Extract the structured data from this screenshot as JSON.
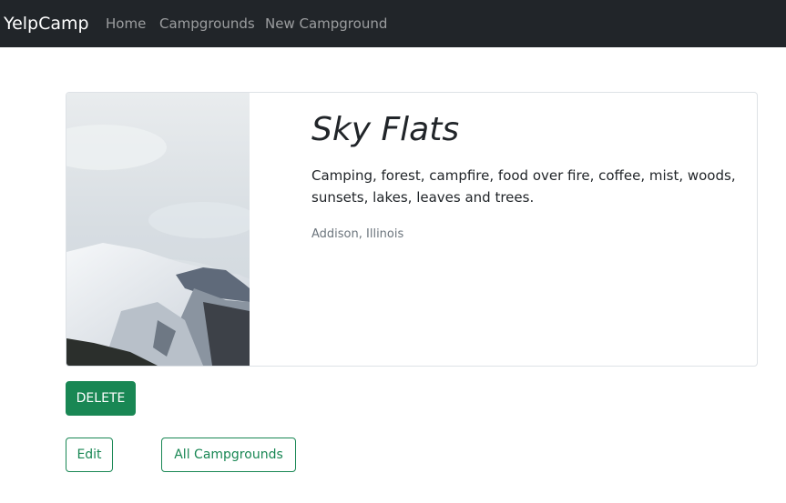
{
  "navbar": {
    "brand": "YelpCamp",
    "links": [
      "Home",
      "Campgrounds",
      "New Campground"
    ]
  },
  "campground": {
    "title": "Sky Flats",
    "description": "Camping, forest, campfire, food over fire, coffee, mist, woods, sunsets, lakes, leaves and trees.",
    "location": "Addison, Illinois"
  },
  "actions": {
    "delete_label": "DELETE",
    "edit_label": "Edit",
    "all_label": "All Campgrounds"
  },
  "colors": {
    "navbar_bg": "#212529",
    "primary_green": "#198754",
    "muted_text": "#6c757d"
  }
}
